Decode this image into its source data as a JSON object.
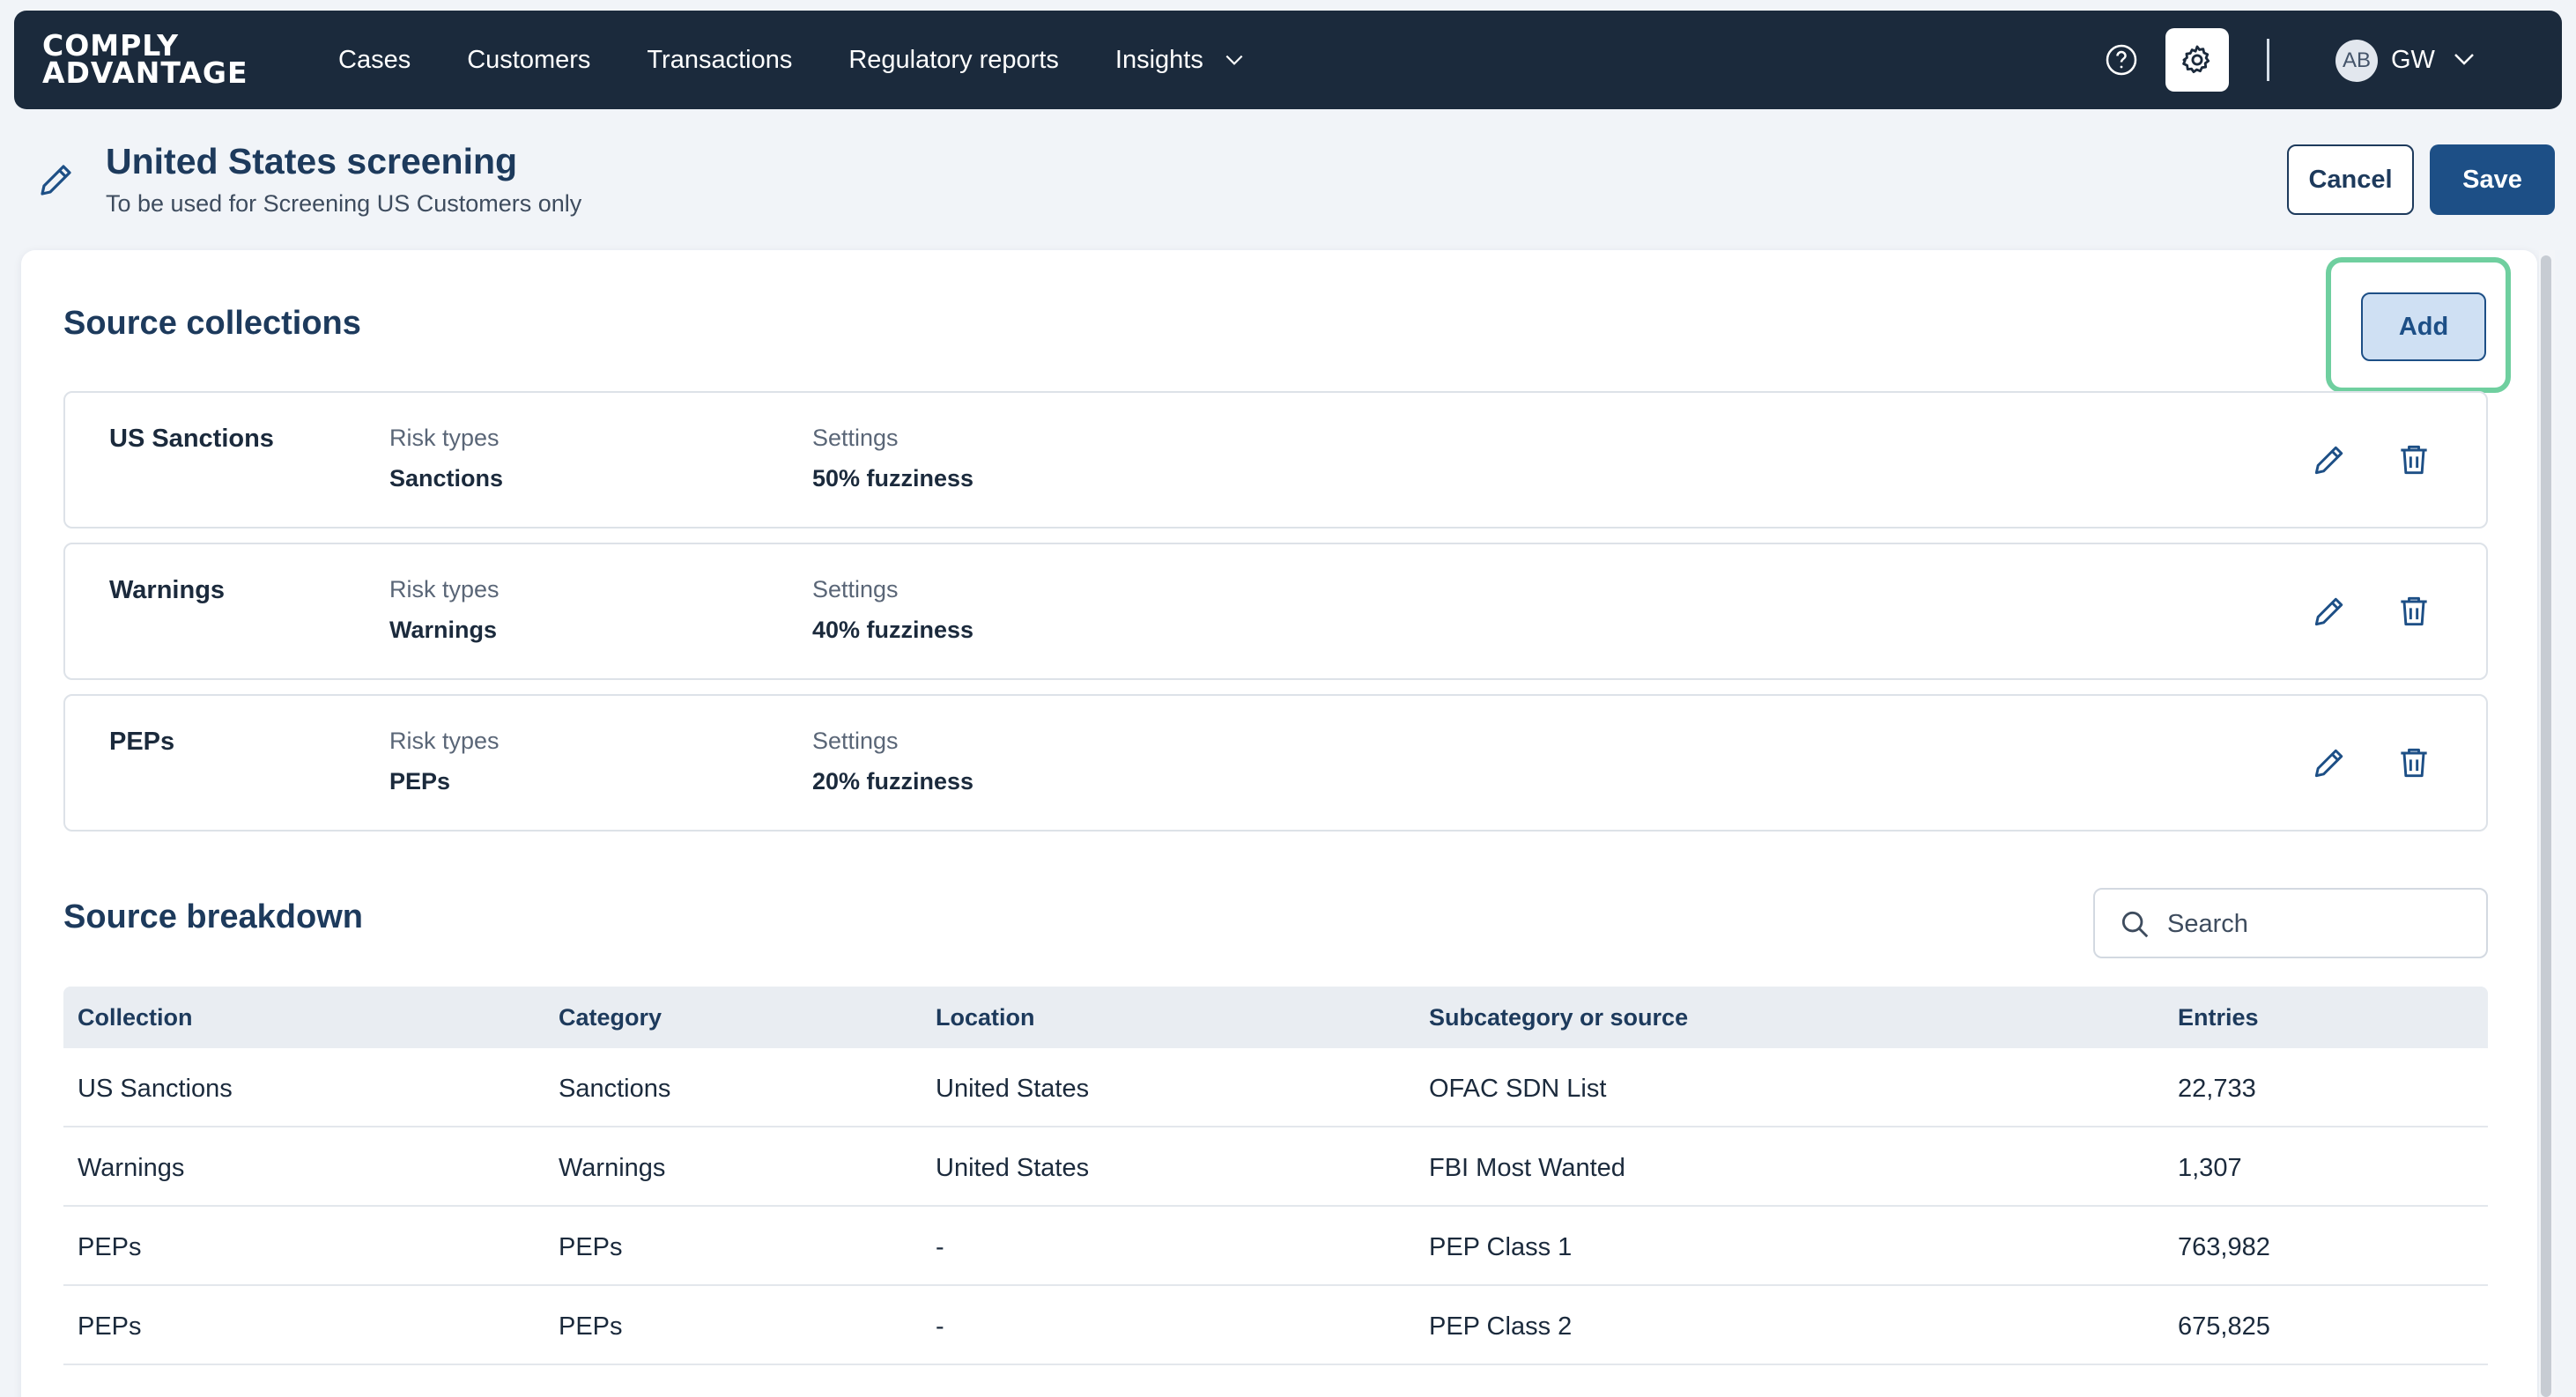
{
  "nav": {
    "logo_line1": "COMPLY",
    "logo_line2": "ADVANTAGE",
    "links": [
      {
        "label": "Cases"
      },
      {
        "label": "Customers"
      },
      {
        "label": "Transactions"
      },
      {
        "label": "Regulatory reports"
      },
      {
        "label": "Insights",
        "dropdown": true
      }
    ],
    "avatar_initials": "AB",
    "user_initials": "GW",
    "icons": [
      "help-circle-icon",
      "gear-icon",
      "chevron-down-icon"
    ]
  },
  "header": {
    "title": "United States screening",
    "subtitle": "To be used for Screening US Customers only",
    "cancel_label": "Cancel",
    "save_label": "Save"
  },
  "source_collections": {
    "title": "Source collections",
    "add_label": "Add",
    "risk_types_label": "Risk types",
    "settings_label": "Settings",
    "items": [
      {
        "name": "US Sanctions",
        "risk_types": "Sanctions",
        "settings": "50% fuzziness"
      },
      {
        "name": "Warnings",
        "risk_types": "Warnings",
        "settings": "40% fuzziness"
      },
      {
        "name": "PEPs",
        "risk_types": "PEPs",
        "settings": "20% fuzziness"
      }
    ]
  },
  "source_breakdown": {
    "title": "Source breakdown",
    "search_placeholder": "Search",
    "columns": [
      "Collection",
      "Category",
      "Location",
      "Subcategory or source",
      "Entries"
    ],
    "rows": [
      [
        "US Sanctions",
        "Sanctions",
        "United States",
        "OFAC SDN List",
        "22,733"
      ],
      [
        "Warnings",
        "Warnings",
        "United States",
        "FBI Most Wanted",
        "1,307"
      ],
      [
        "PEPs",
        "PEPs",
        "-",
        "PEP Class 1",
        "763,982"
      ],
      [
        "PEPs",
        "PEPs",
        "-",
        "PEP Class 2",
        "675,825"
      ]
    ]
  },
  "colors": {
    "nav_bg": "#1b2a3c",
    "primary": "#1d4f86",
    "highlight": "#6fcf9f"
  }
}
